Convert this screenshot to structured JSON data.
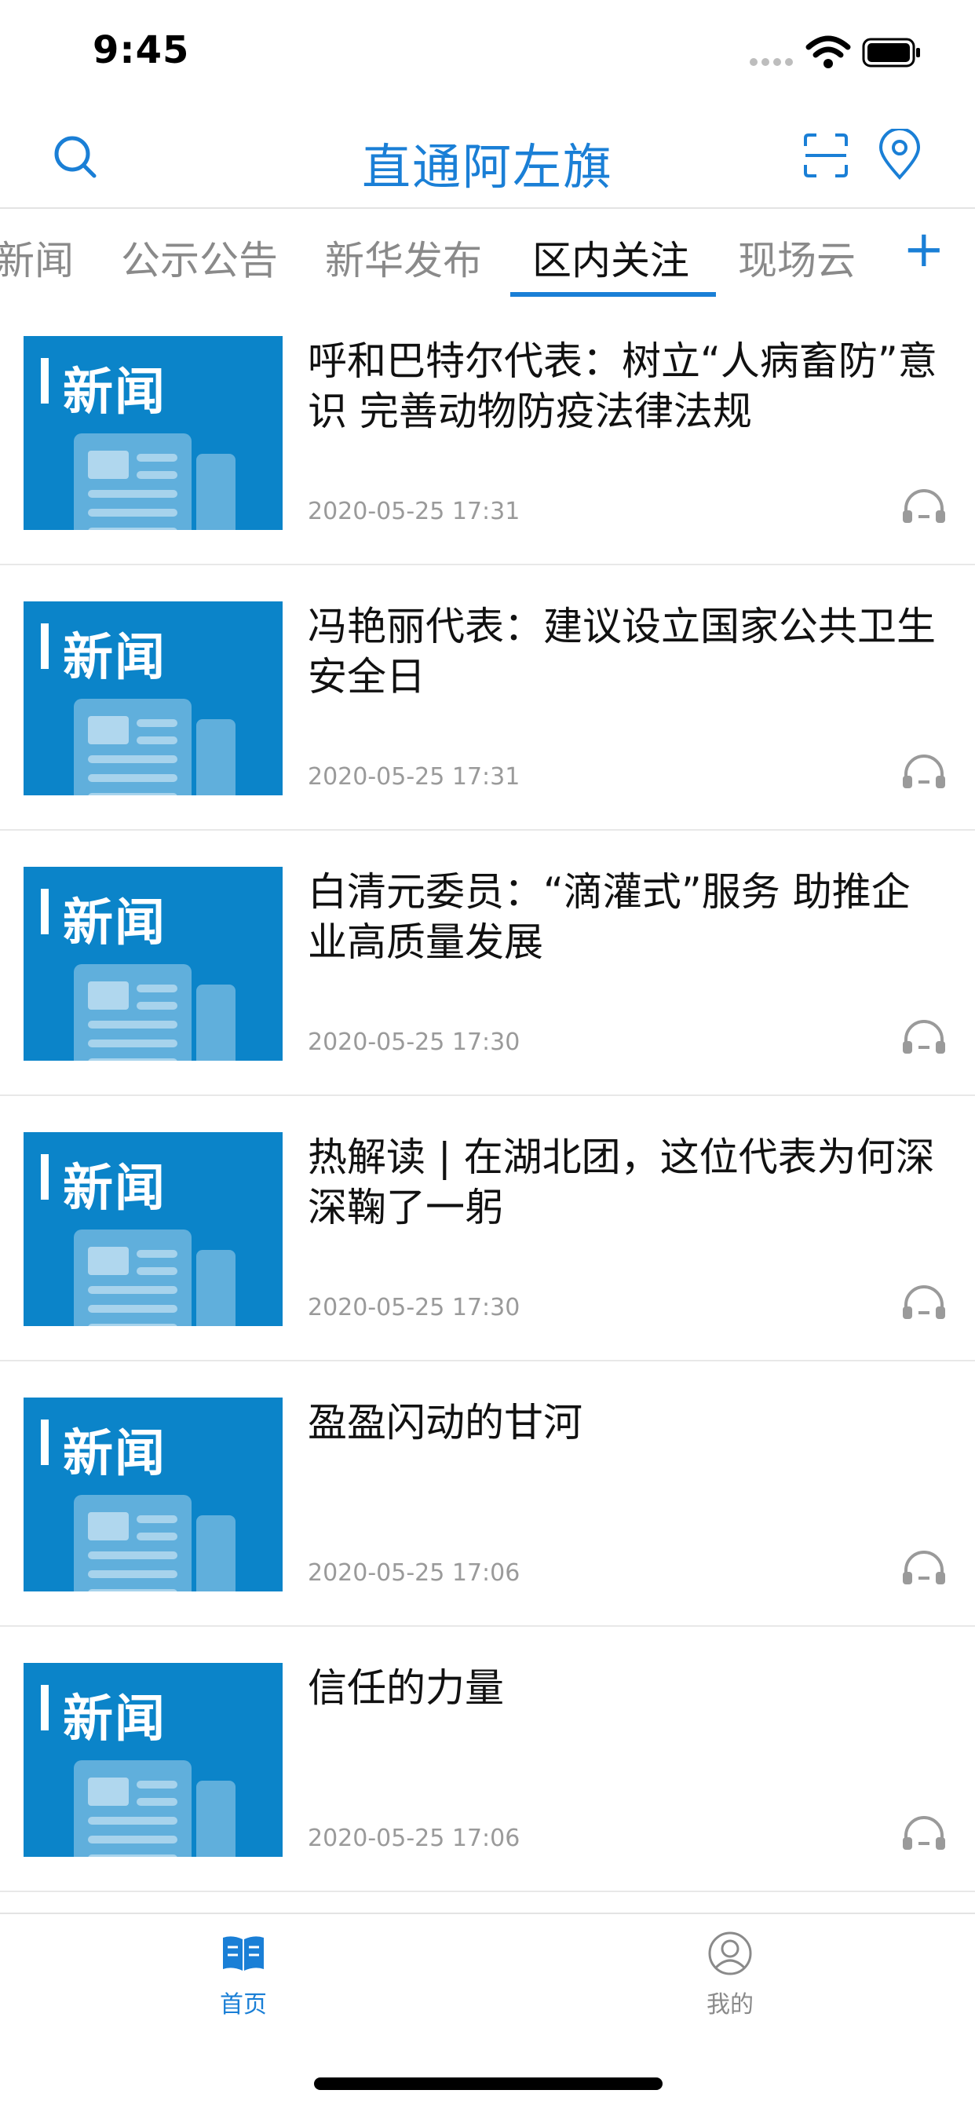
{
  "status_bar": {
    "time": "9:45"
  },
  "header": {
    "title": "直通阿左旗"
  },
  "tabs": [
    {
      "label": "新闻",
      "active": false
    },
    {
      "label": "公示公告",
      "active": false
    },
    {
      "label": "新华发布",
      "active": false
    },
    {
      "label": "区内关注",
      "active": true
    },
    {
      "label": "现场云",
      "active": false
    }
  ],
  "tabs_more": "+",
  "thumb_label": "新闻",
  "news": [
    {
      "title": "呼和巴特尔代表：树立“人病畜防”意识 完善动物防疫法律法规",
      "time": "2020-05-25 17:31"
    },
    {
      "title": "冯艳丽代表：建议设立国家公共卫生安全日",
      "time": "2020-05-25 17:31"
    },
    {
      "title": "白清元委员：“滴灌式”服务 助推企业高质量发展",
      "time": "2020-05-25 17:30"
    },
    {
      "title": "热解读 | 在湖北团，这位代表为何深深鞠了一躬",
      "time": "2020-05-25 17:30"
    },
    {
      "title": "盈盈闪动的甘河",
      "time": "2020-05-25 17:06"
    },
    {
      "title": "信任的力量",
      "time": "2020-05-25 17:06"
    }
  ],
  "tabbar": [
    {
      "label": "首页",
      "active": true
    },
    {
      "label": "我的",
      "active": false
    }
  ],
  "colors": {
    "accent": "#1a7fd6",
    "thumb_bg": "#0b84c9",
    "muted": "#9a9a9a"
  }
}
